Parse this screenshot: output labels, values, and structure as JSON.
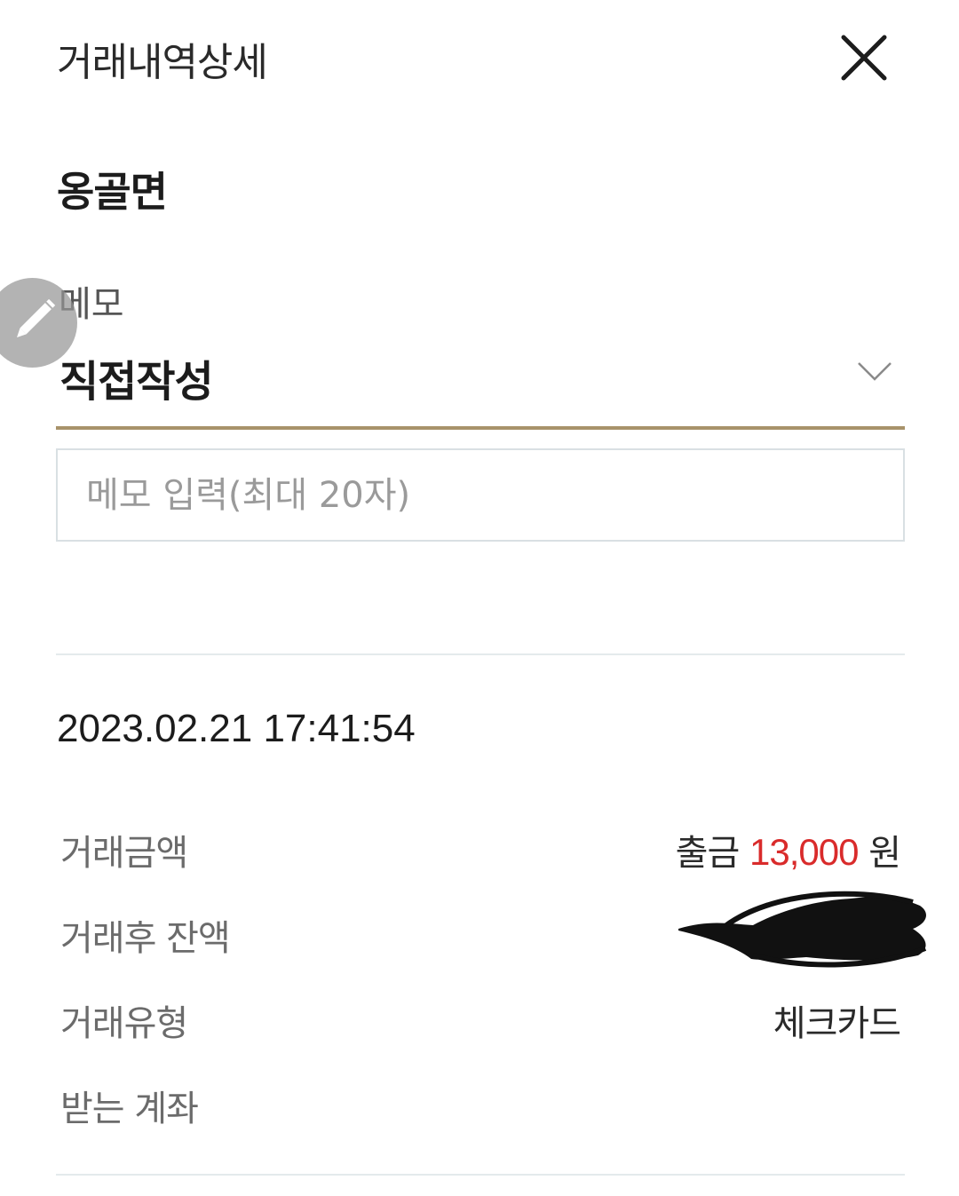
{
  "header": {
    "title": "거래내역상세",
    "close_icon": "close-icon"
  },
  "merchant": {
    "name": "옹골면"
  },
  "memo": {
    "label": "메모",
    "edit_icon": "pencil-icon",
    "select_value": "직접작성",
    "select_icon": "chevron-down-icon",
    "input_placeholder": "메모 입력(최대 20자)",
    "input_value": "",
    "accent_color": "#a8926a"
  },
  "transaction": {
    "datetime": "2023.02.21 17:41:54",
    "rows": [
      {
        "label": "거래금액",
        "value_prefix": "출금",
        "value_amount": "13,000",
        "value_suffix": "원",
        "amount_color": "#d92b2b"
      },
      {
        "label": "거래후 잔액",
        "value": ""
      },
      {
        "label": "거래유형",
        "value": "체크카드"
      },
      {
        "label": "받는 계좌",
        "value": ""
      }
    ]
  }
}
